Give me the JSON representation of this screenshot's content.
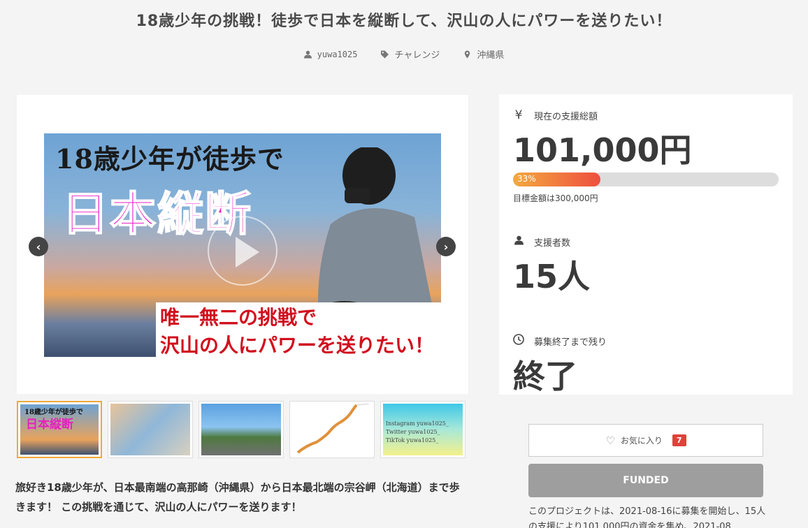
{
  "header": {
    "title": "18歳少年の挑戦！徒歩で日本を縦断して、沢山の人にパワーを送りたい！",
    "owner": "yuwa1025",
    "category": "チャレンジ",
    "location": "沖縄県"
  },
  "media": {
    "hero_line1": "18歳少年が徒歩で",
    "hero_line2": "日本縦断",
    "hero_line3": "唯一無二の挑戦で",
    "hero_line4": "沢山の人にパワーを送りたい！",
    "thumb1_line1": "18歳少年が徒歩で",
    "thumb1_line2": "日本縦断",
    "thumb5_lines": [
      "Instagram  yuwa1025_",
      "Twitter  yuwa1025_",
      "TikTok  yuwa1025_"
    ]
  },
  "description": "旅好き18歳少年が、日本最南端の高那崎（沖縄県）から日本最北端の宗谷岬（北海道）まで歩きます！ この挑戦を通じて、沢山の人にパワーを送ります！",
  "stats": {
    "total_label": "現在の支援総額",
    "total_value": "101,000円",
    "progress_percent": 33,
    "progress_text": "33%",
    "goal_text": "目標金額は300,000円",
    "supporters_label": "支援者数",
    "supporters_value": "15人",
    "remaining_label": "募集終了まで残り",
    "remaining_value": "終了"
  },
  "actions": {
    "favorite_label": "お気に入り",
    "favorite_count": "7",
    "funded_label": "FUNDED"
  },
  "summary": "このプロジェクトは、2021-08-16に募集を開始し、15人の支援により101,000円の資金を集め、2021-08",
  "colors": {
    "accent": "#ee4f3f",
    "progress_start": "#f3a93f",
    "funded_bg": "#9e9e9e"
  }
}
